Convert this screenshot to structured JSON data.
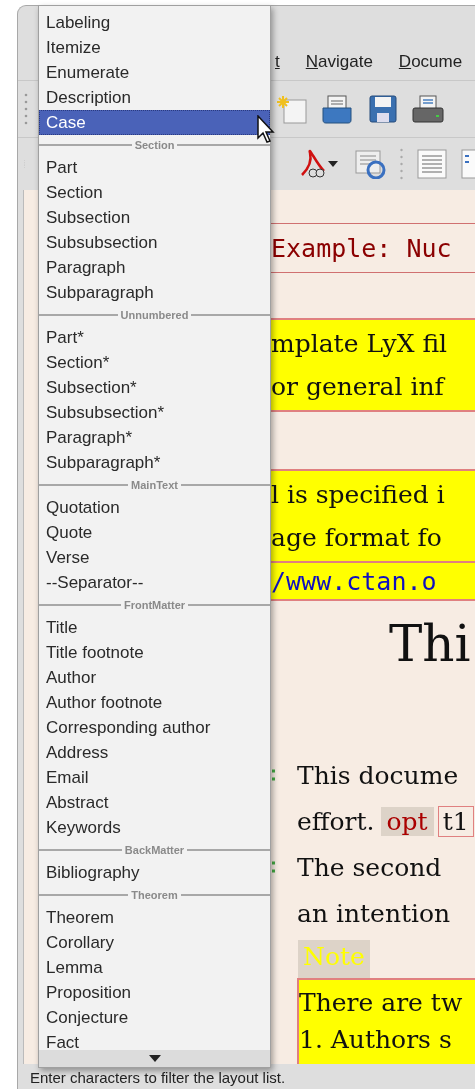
{
  "menu_bar": [
    {
      "label": "t"
    },
    {
      "label": "Navigate"
    },
    {
      "label": "Docume"
    }
  ],
  "document": {
    "blocks": [
      {
        "kind": "title",
        "lines": [
          "Example: Nuc"
        ]
      },
      {
        "kind": "note_box",
        "lines": [
          "mplate LyX fil",
          "or general inf"
        ]
      },
      {
        "kind": "note_box",
        "lines": [
          "l is specified i",
          "age  format  fo"
        ]
      },
      {
        "kind": "link_box",
        "lines": [
          "/www.ctan.o"
        ]
      },
      {
        "kind": "heading",
        "lines": [
          "Thi"
        ]
      },
      {
        "kind": "paragraph",
        "marked": true,
        "lines": [
          "This docume"
        ]
      },
      {
        "kind": "inset_line",
        "parts": [
          "effort.",
          "opt",
          "t1"
        ]
      },
      {
        "kind": "paragraph",
        "marked": true,
        "lines": [
          "The second"
        ]
      },
      {
        "kind": "paragraph",
        "marked": false,
        "lines": [
          "an intention"
        ]
      },
      {
        "kind": "note_label",
        "lines": [
          "Note"
        ]
      },
      {
        "kind": "note_box",
        "lines": [
          "There are tw",
          "1. Authors s"
        ]
      }
    ]
  },
  "layout_dropdown": {
    "groups": [
      {
        "items": [
          {
            "label": "Labeling",
            "selected": false
          },
          {
            "label": "Itemize",
            "selected": false
          },
          {
            "label": "Enumerate",
            "selected": false
          },
          {
            "label": "Description",
            "selected": false
          },
          {
            "label": "Case",
            "selected": true
          }
        ]
      },
      {
        "heading": "Section",
        "items": [
          {
            "label": "Part",
            "selected": false
          },
          {
            "label": "Section",
            "selected": false
          },
          {
            "label": "Subsection",
            "selected": false
          },
          {
            "label": "Subsubsection",
            "selected": false
          },
          {
            "label": "Paragraph",
            "selected": false
          },
          {
            "label": "Subparagraph",
            "selected": false
          }
        ]
      },
      {
        "heading": "Unnumbered",
        "items": [
          {
            "label": "Part*",
            "selected": false
          },
          {
            "label": "Section*",
            "selected": false
          },
          {
            "label": "Subsection*",
            "selected": false
          },
          {
            "label": "Subsubsection*",
            "selected": false
          },
          {
            "label": "Paragraph*",
            "selected": false
          },
          {
            "label": "Subparagraph*",
            "selected": false
          }
        ]
      },
      {
        "heading": "MainText",
        "items": [
          {
            "label": "Quotation",
            "selected": false
          },
          {
            "label": "Quote",
            "selected": false
          },
          {
            "label": "Verse",
            "selected": false
          },
          {
            "label": "--Separator--",
            "selected": false
          }
        ]
      },
      {
        "heading": "FrontMatter",
        "items": [
          {
            "label": "Title",
            "selected": false
          },
          {
            "label": "Title footnote",
            "selected": false
          },
          {
            "label": "Author",
            "selected": false
          },
          {
            "label": "Author footnote",
            "selected": false
          },
          {
            "label": "Corresponding author",
            "selected": false
          },
          {
            "label": "Address",
            "selected": false
          },
          {
            "label": "Email",
            "selected": false
          },
          {
            "label": "Abstract",
            "selected": false
          },
          {
            "label": "Keywords",
            "selected": false
          }
        ]
      },
      {
        "heading": "BackMatter",
        "items": [
          {
            "label": "Bibliography",
            "selected": false
          }
        ]
      },
      {
        "heading": "Theorem",
        "items": [
          {
            "label": "Theorem",
            "selected": false
          },
          {
            "label": "Corollary",
            "selected": false
          },
          {
            "label": "Lemma",
            "selected": false
          },
          {
            "label": "Proposition",
            "selected": false
          },
          {
            "label": "Conjecture",
            "selected": false
          },
          {
            "label": "Fact",
            "selected": false
          }
        ]
      }
    ]
  },
  "status_bar": {
    "text": "Enter characters to filter the layout list."
  }
}
